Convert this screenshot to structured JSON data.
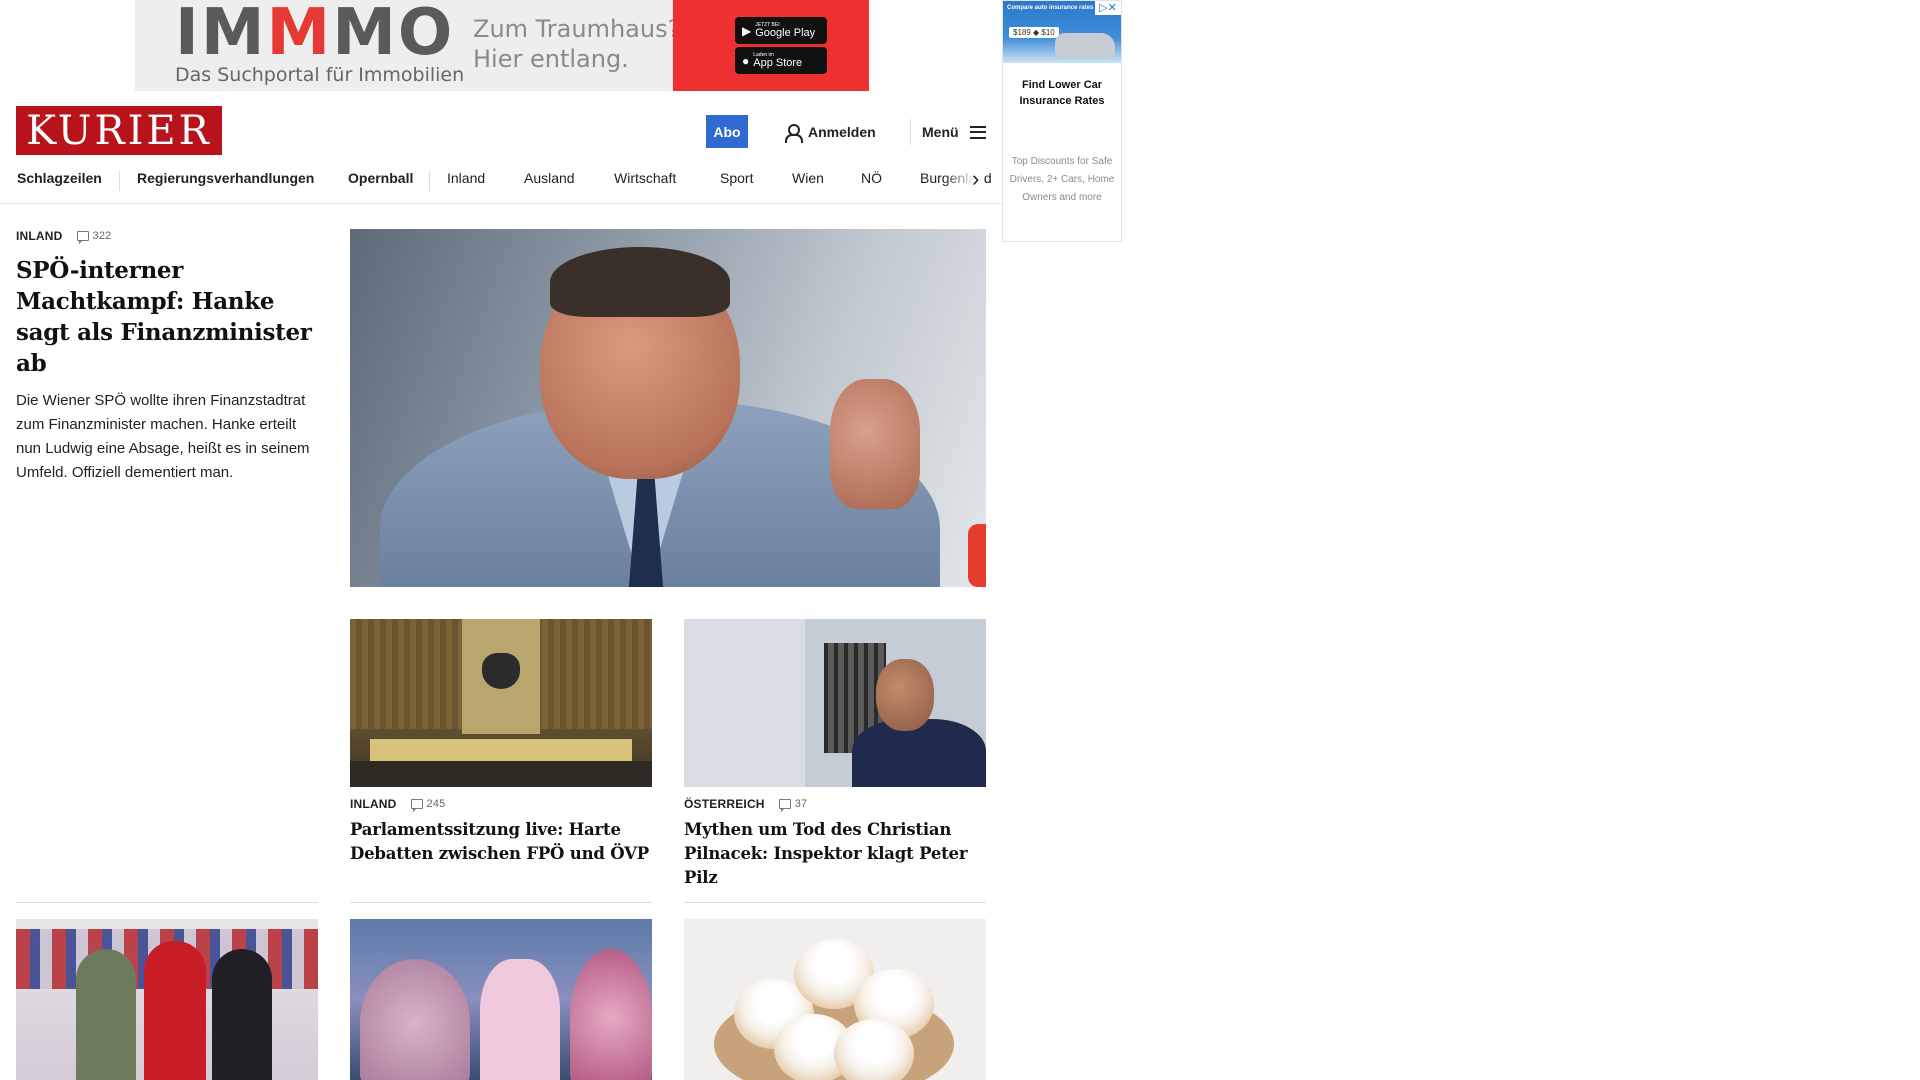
{
  "banner_ad": {
    "brand_part1": "IM",
    "brand_part2": "M",
    "brand_part3": "MO",
    "subtitle": "Das Suchportal für Immobilien",
    "claim_line1": "Zum Traumhaus?",
    "claim_line2": "Hier entlang.",
    "google_play_small": "JETZT BEI",
    "google_play_big": "Google Play",
    "app_store_small": "Laden im",
    "app_store_big": "App Store",
    "accent_color": "#ee3130"
  },
  "side_ad": {
    "image_caption": "Compare auto insurance rates",
    "price_tag": "$189 ◆ $10",
    "headline": "Find Lower Car Insurance Rates",
    "description": "Top Discounts for Safe Drivers, 2+ Cars, Home Owners and more",
    "ad_choices": "▷✕"
  },
  "header": {
    "logo": "KURIER",
    "logo_color": "#b8121b",
    "abo_label": "Abo",
    "login_label": "Anmelden",
    "menu_label": "Menü"
  },
  "nav": {
    "items": [
      "Schlagzeilen",
      "Regierungsverhandlungen",
      "Opernball",
      "Inland",
      "Ausland",
      "Wirtschaft",
      "Sport",
      "Wien",
      "NÖ",
      "Burgenland"
    ]
  },
  "lead": {
    "category": "INLAND",
    "comments": "322",
    "title": "SPÖ-interner Machtkampf: Hanke sagt als Finanzminister ab",
    "teaser": "Die Wiener SPÖ wollte ihren Finanzstadtrat zum Finanzminister machen. Hanke erteilt nun Ludwig eine Absage, heißt es in seinem Umfeld. Offiziell dementiert man."
  },
  "cards": [
    {
      "category": "INLAND",
      "comments": "245",
      "title": "Parlamentssitzung live: Harte Debatten zwischen FPÖ und ÖVP"
    },
    {
      "category": "ÖSTERREICH",
      "comments": "37",
      "title": "Mythen um Tod des Christian Pilnacek: Inspektor klagt Peter Pilz"
    }
  ]
}
